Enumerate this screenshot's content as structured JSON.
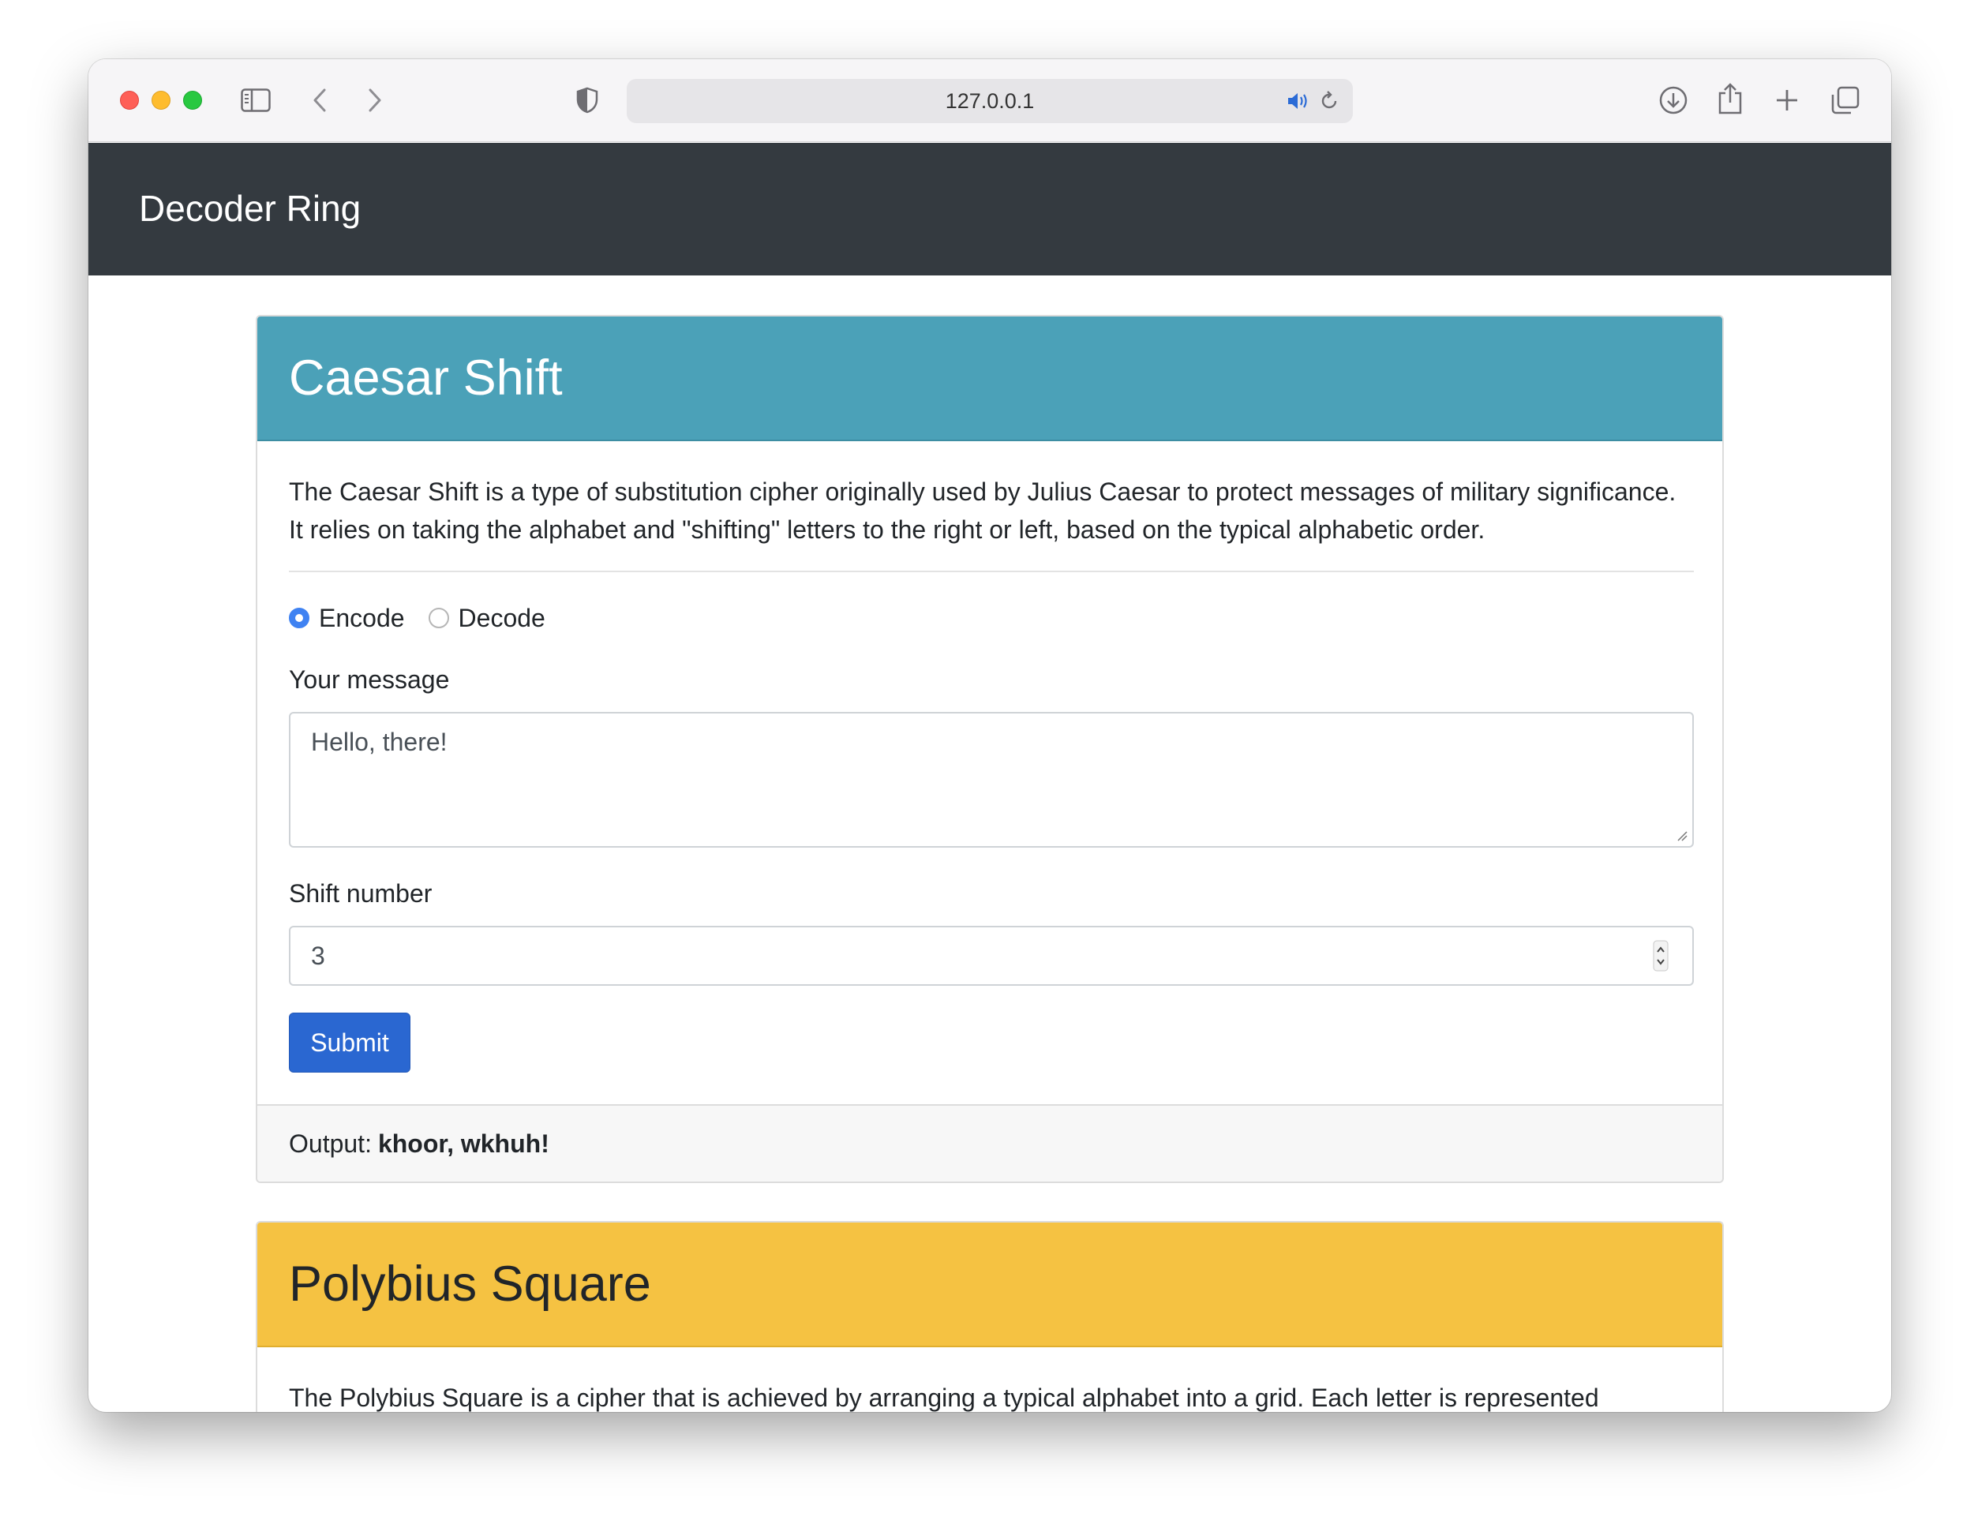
{
  "browser": {
    "url": "127.0.0.1",
    "icons": [
      "sidebar-icon",
      "back-arrow-icon",
      "forward-arrow-icon",
      "shield-icon",
      "speaker-icon",
      "reload-icon",
      "download-icon",
      "share-icon",
      "new-tab-icon",
      "tab-overview-icon"
    ]
  },
  "navbar": {
    "brand": "Decoder Ring"
  },
  "caesar": {
    "title": "Caesar Shift",
    "description": "The Caesar Shift is a type of substitution cipher originally used by Julius Caesar to protect messages of military significance. It relies on taking the alphabet and \"shifting\" letters to the right or left, based on the typical alphabetic order.",
    "mode_encode": "Encode",
    "mode_decode": "Decode",
    "selected_mode": "Encode",
    "message_label": "Your message",
    "message_value": "Hello, there!",
    "shift_label": "Shift number",
    "shift_value": "3",
    "submit_label": "Submit",
    "output_label": "Output:",
    "output_value": "khoor, wkhuh!"
  },
  "polybius": {
    "title": "Polybius Square",
    "description": "The Polybius Square is a cipher that is achieved by arranging a typical alphabet into a grid. Each letter is represented"
  },
  "colors": {
    "navbar": "#343a40",
    "caesar_header": "#4ba1b8",
    "polybius_header": "#f5c242",
    "primary_button": "#2a67d1",
    "radio_checked": "#3f82f2"
  }
}
